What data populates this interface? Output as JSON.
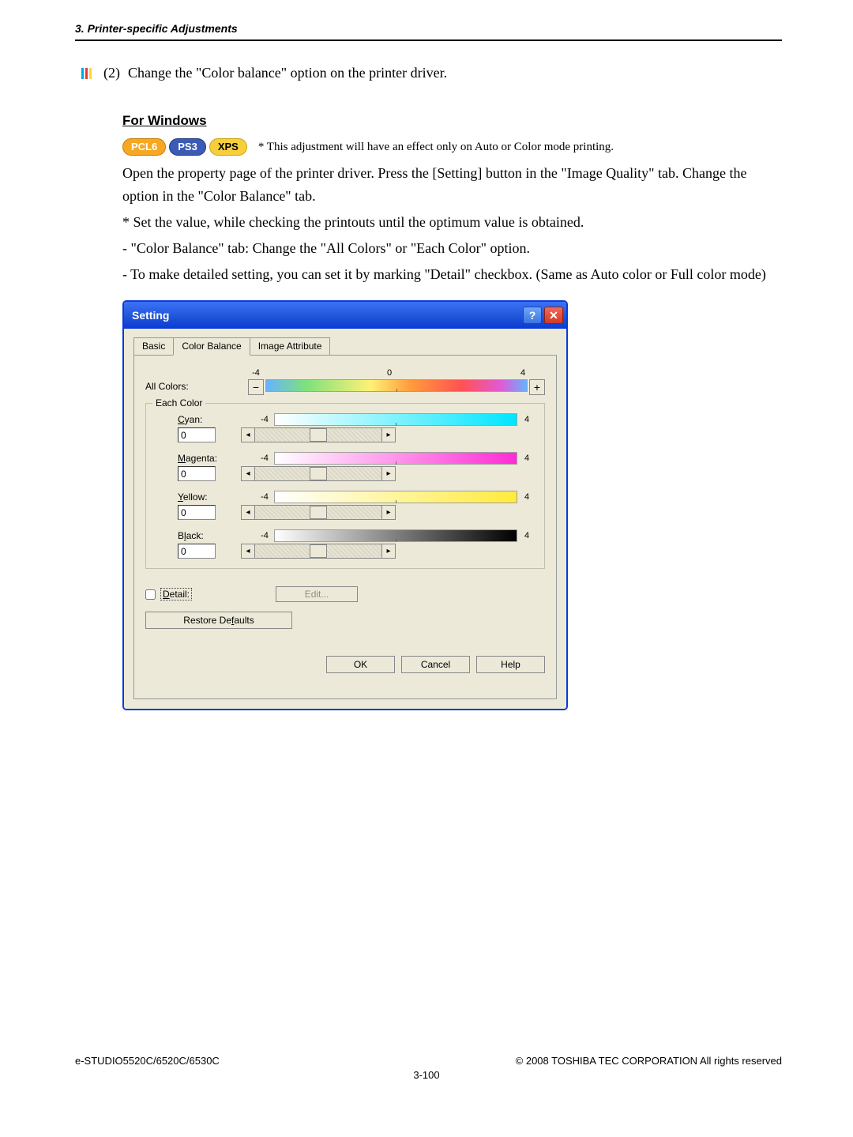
{
  "header": "3. Printer-specific Adjustments",
  "step": {
    "num": "(2)",
    "text": "Change the \"Color balance\" option on the printer driver."
  },
  "section_title": "For Windows",
  "badges": {
    "pcl6": "PCL6",
    "ps3": "PS3",
    "xps": "XPS",
    "note": "* This adjustment will have an effect only on Auto or Color mode printing."
  },
  "paragraphs": {
    "p1": "Open the property page of the printer driver. Press the [Setting] button in the \"Image Quality\" tab. Change the option in the \"Color Balance\" tab.",
    "p2": "* Set the value, while checking the printouts until the optimum value is obtained.",
    "p3": "- \"Color Balance\" tab: Change the \"All Colors\" or \"Each Color\" option.",
    "p4": "- To make detailed setting, you can set it by marking \"Detail\" checkbox. (Same as Auto color or Full color mode)"
  },
  "dialog": {
    "title": "Setting",
    "tabs": {
      "t1": "Basic",
      "t2": "Color Balance",
      "t3": "Image Attribute"
    },
    "scale": {
      "min": "-4",
      "zero": "0",
      "max": "4"
    },
    "all_label": "All Colors:",
    "each_label": "Each Color",
    "controls": {
      "cyan": {
        "label_first": "C",
        "label_rest": "yan:",
        "value": "0"
      },
      "magenta": {
        "label_first": "M",
        "label_rest": "agenta:",
        "value": "0"
      },
      "yellow": {
        "label_first": "Y",
        "label_rest": "ellow:",
        "value": "0"
      },
      "black": {
        "label_first": "B",
        "label_rest": "lack:",
        "label_ul": "l",
        "value": "0"
      }
    },
    "minus": "−",
    "plus": "+",
    "arrow_left": "◂",
    "arrow_right": "▸",
    "detail": {
      "label_first": "D",
      "label_rest": "etail:"
    },
    "edit": "Edit...",
    "restore": {
      "pre": "Restore De",
      "ul": "f",
      "post": "aults"
    },
    "buttons": {
      "ok": "OK",
      "cancel": "Cancel",
      "help": "Help"
    }
  },
  "footer": {
    "left": "e-STUDIO5520C/6520C/6530C",
    "right": "© 2008 TOSHIBA TEC CORPORATION All rights reserved",
    "page": "3-100"
  }
}
